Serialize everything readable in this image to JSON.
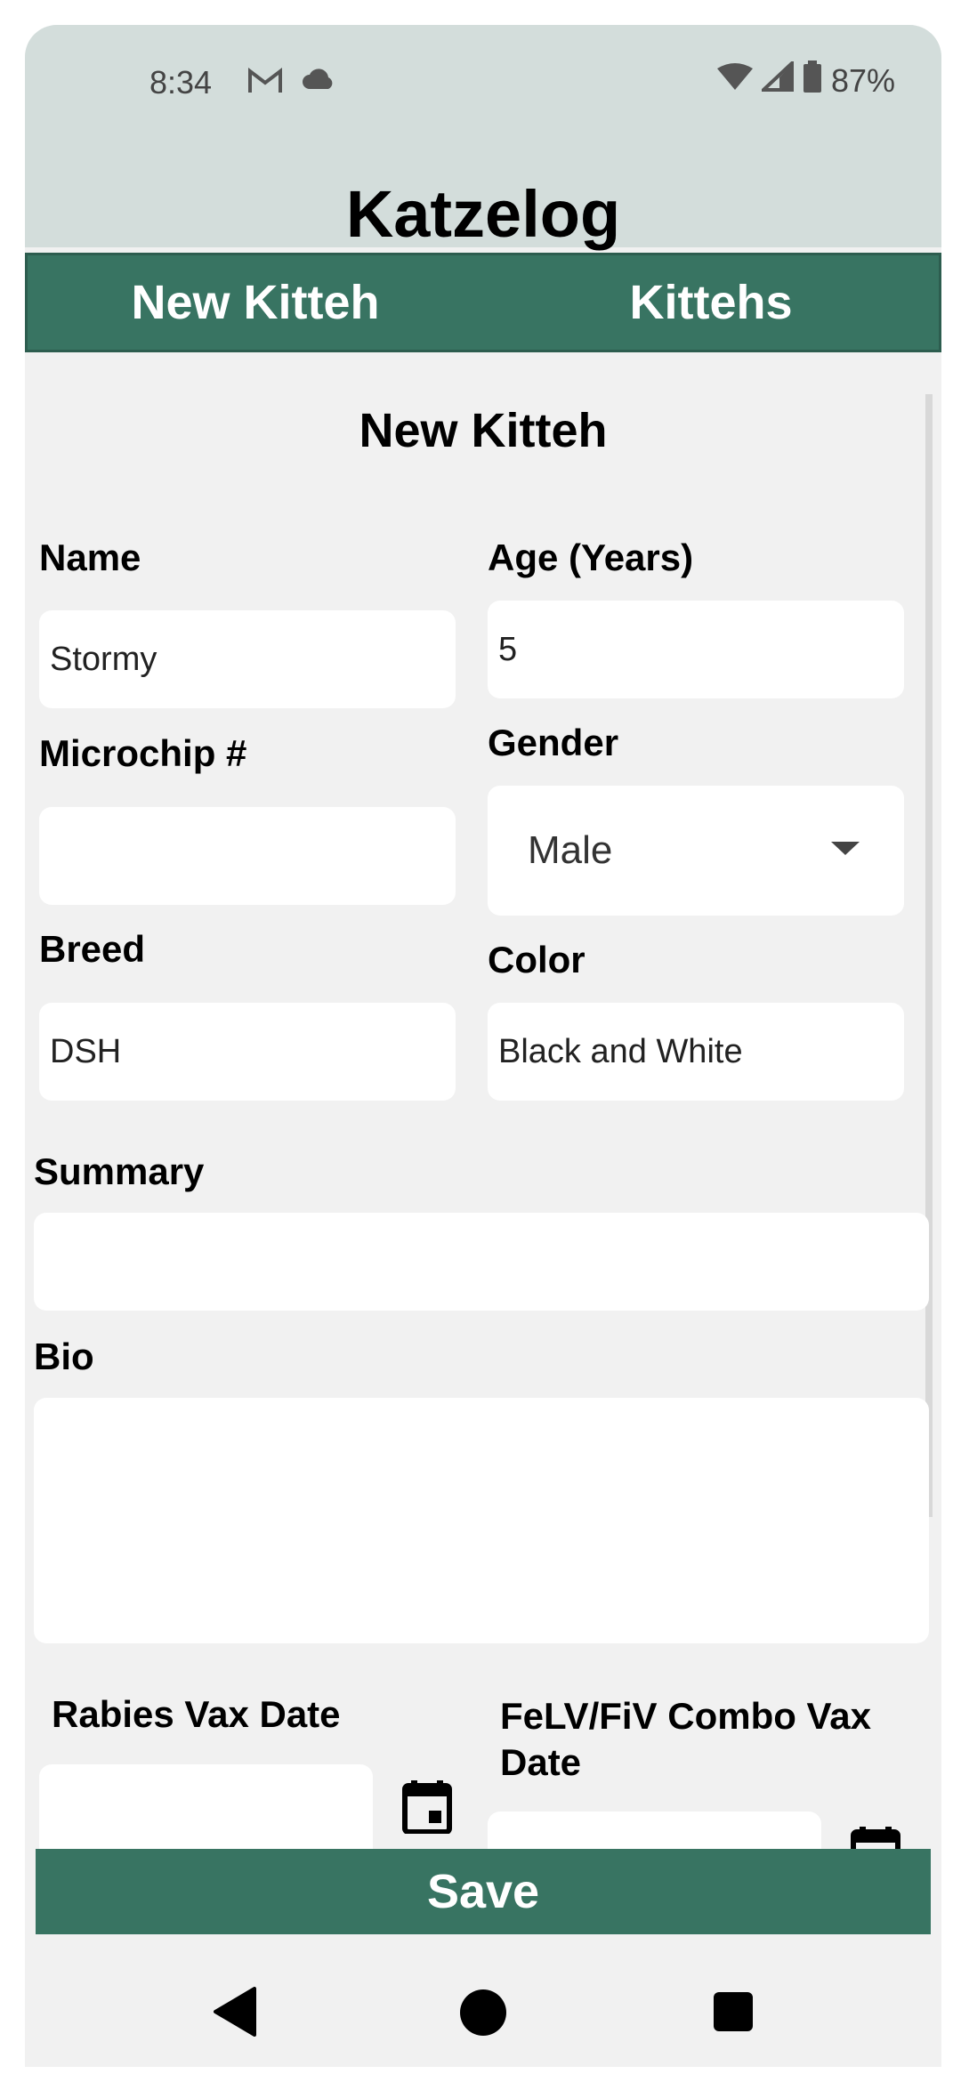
{
  "status_bar": {
    "time": "8:34",
    "left_icons": [
      "gmail-icon",
      "cloud-icon"
    ],
    "right_icons": [
      "wifi-icon",
      "signal-icon",
      "battery-icon"
    ],
    "battery": "87%"
  },
  "app": {
    "title": "Katzelog"
  },
  "tabs": [
    {
      "label": "New Kitteh"
    },
    {
      "label": "Kittehs"
    }
  ],
  "form": {
    "title": "New Kitteh",
    "name": {
      "label": "Name",
      "value": "Stormy"
    },
    "age": {
      "label": "Age (Years)",
      "value": "5"
    },
    "microchip": {
      "label": "Microchip #",
      "value": ""
    },
    "gender": {
      "label": "Gender",
      "value": "Male"
    },
    "breed": {
      "label": "Breed",
      "value": "DSH"
    },
    "color": {
      "label": "Color",
      "value": "Black and White"
    },
    "summary": {
      "label": "Summary",
      "value": ""
    },
    "bio": {
      "label": "Bio",
      "value": ""
    },
    "rabies": {
      "label": "Rabies Vax Date",
      "value": ""
    },
    "felv": {
      "label_line1": "FeLV/FiV Combo Vax",
      "label_line2": "Date",
      "value": ""
    }
  },
  "save_label": "Save",
  "colors": {
    "accent": "#387462",
    "header_bg": "#d3dddb",
    "page_bg": "#f1f1f1"
  },
  "nav_icons": [
    "back-icon",
    "home-icon",
    "recents-icon"
  ]
}
